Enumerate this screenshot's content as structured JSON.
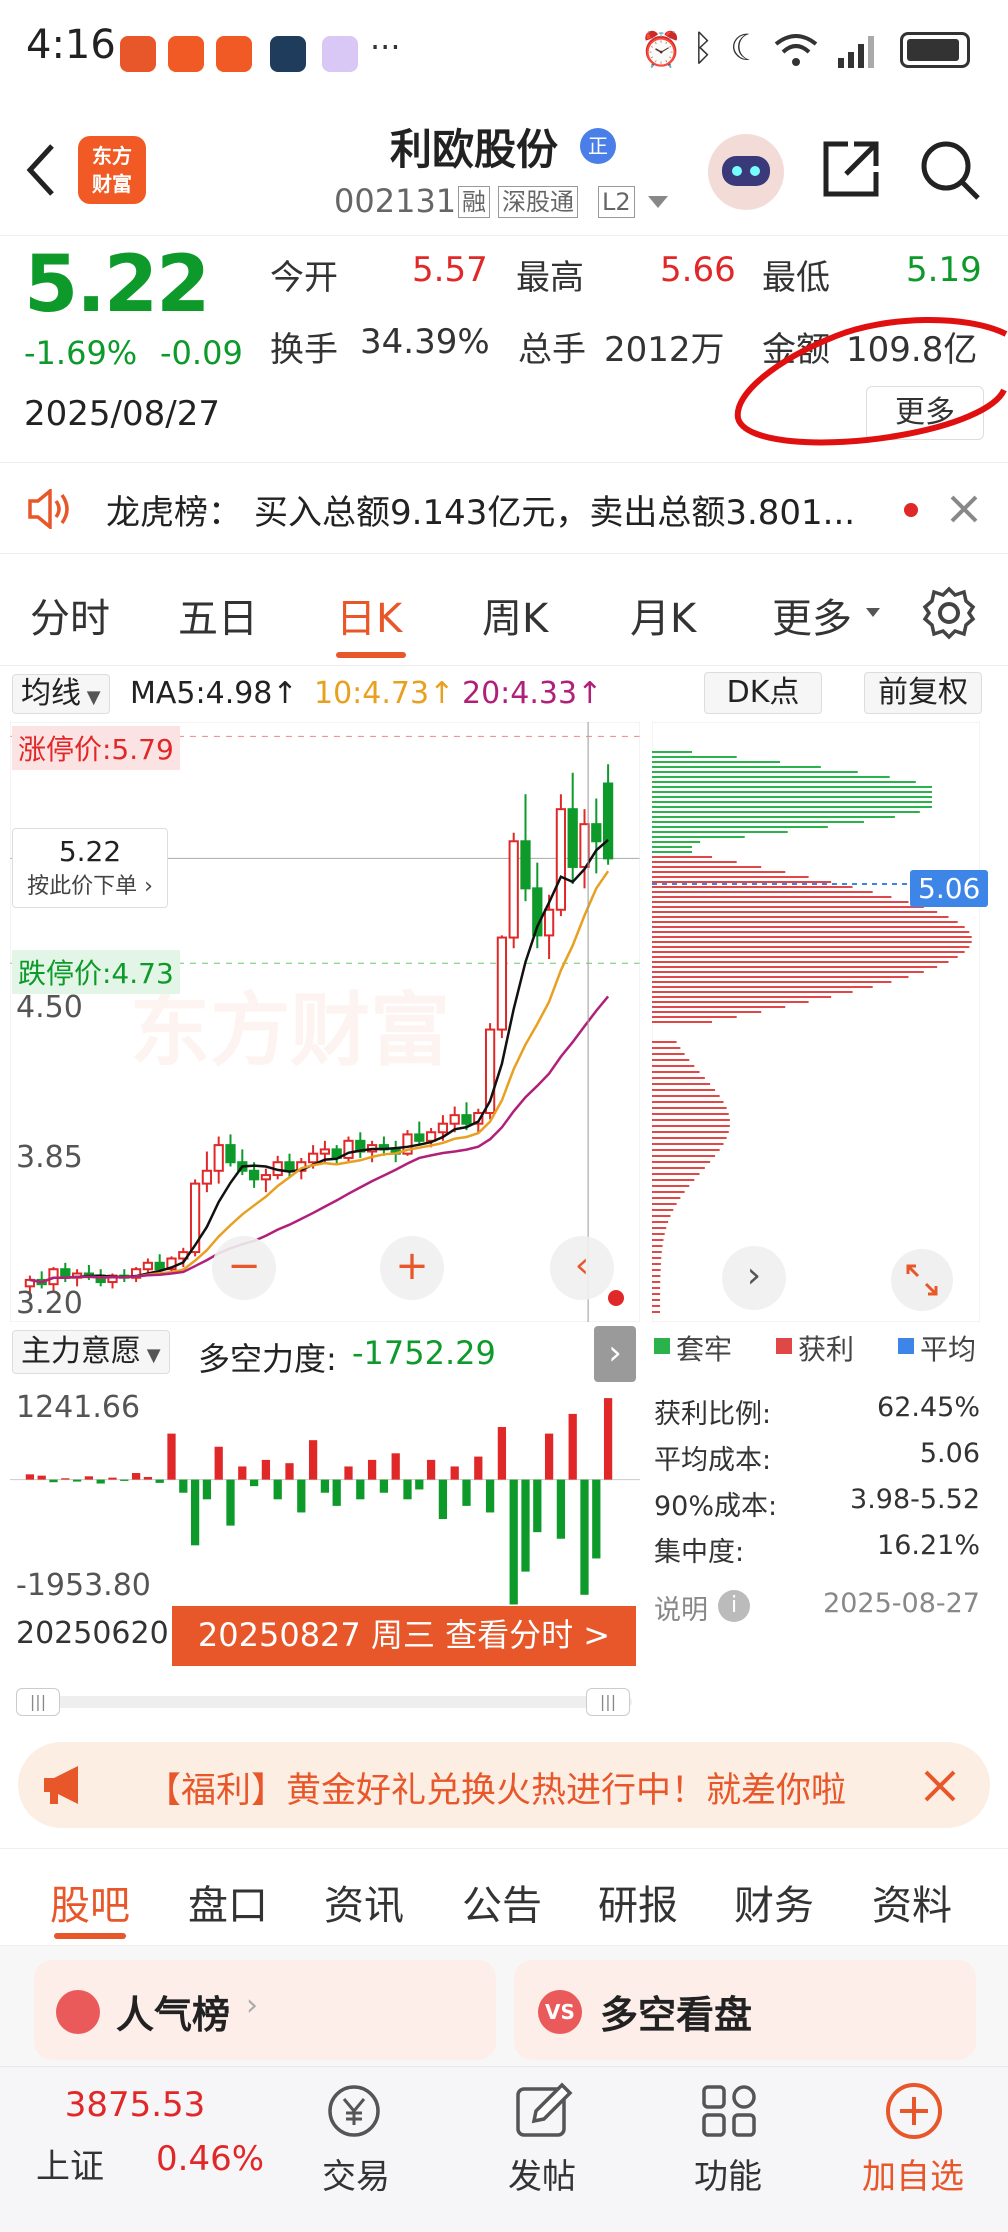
{
  "status": {
    "time": "4:16"
  },
  "nav": {
    "back_icon": "chevron-left-icon",
    "logo_line1": "东方",
    "logo_line2": "财富",
    "stock_name": "利欧股份",
    "name_badge": "正",
    "stock_code": "002131",
    "tag_rong": "融",
    "tag_sgt": "深股通",
    "tag_l2": "L2"
  },
  "quote": {
    "price": "5.22",
    "change_pct": "-1.69%",
    "change_amt": "-0.09",
    "date": "2025/08/27",
    "open_label": "今开",
    "open_value": "5.57",
    "high_label": "最高",
    "high_value": "5.66",
    "low_label": "最低",
    "low_value": "5.19",
    "turnover_label": "换手",
    "turnover_value": "34.39%",
    "volume_label": "总手",
    "volume_value": "2012万",
    "amount_label": "金额",
    "amount_value": "109.8亿",
    "more_button": "更多",
    "colors": {
      "up": "#e02828",
      "down": "#0d9a2a"
    }
  },
  "banner1": {
    "label": "龙虎榜：",
    "text": "买入总额9.143亿元，卖出总额3.801..."
  },
  "ktabs": {
    "tabs": [
      "分时",
      "五日",
      "日K",
      "周K",
      "月K",
      "更多"
    ],
    "active": "日K",
    "settings_icon": "gear-icon"
  },
  "chart": {
    "ma_select": "均线",
    "ma5": "MA5:4.98↑",
    "ma10": "10:4.73↑",
    "ma20": "20:4.33↑",
    "dk_button": "DK点",
    "fq_button": "前复权",
    "limit_up": "涨停价:5.79",
    "current_price": "5.22",
    "order_hint": "按此价下单",
    "limit_down": "跌停价:4.73",
    "y_labels": [
      "4.50",
      "3.85",
      "3.20"
    ],
    "cost_marker": "5.06",
    "indicator_select": "主力意愿",
    "force_label": "多空力度:",
    "force_value": "-1752.29",
    "ind_max": "1241.66",
    "ind_min": "-1953.80",
    "start_date": "20250620",
    "selected_date": "20250827 周三 查看分时 >"
  },
  "chart_data": {
    "type": "candlestick",
    "ma_values": {
      "MA5": 4.98,
      "MA10": 4.73,
      "MA20": 4.33
    },
    "limit_up": 5.79,
    "limit_down": 4.73,
    "last_close": 5.22,
    "candles": [
      [
        3.22,
        3.27,
        3.18,
        3.25
      ],
      [
        3.25,
        3.29,
        3.21,
        3.23
      ],
      [
        3.23,
        3.31,
        3.2,
        3.3
      ],
      [
        3.3,
        3.33,
        3.24,
        3.26
      ],
      [
        3.26,
        3.3,
        3.22,
        3.28
      ],
      [
        3.28,
        3.32,
        3.25,
        3.27
      ],
      [
        3.27,
        3.3,
        3.22,
        3.24
      ],
      [
        3.24,
        3.28,
        3.21,
        3.27
      ],
      [
        3.27,
        3.3,
        3.24,
        3.26
      ],
      [
        3.26,
        3.31,
        3.24,
        3.3
      ],
      [
        3.3,
        3.35,
        3.27,
        3.33
      ],
      [
        3.33,
        3.37,
        3.28,
        3.3
      ],
      [
        3.3,
        3.36,
        3.28,
        3.35
      ],
      [
        3.35,
        3.4,
        3.31,
        3.38
      ],
      [
        3.38,
        3.72,
        3.36,
        3.7
      ],
      [
        3.7,
        3.85,
        3.66,
        3.76
      ],
      [
        3.76,
        3.92,
        3.7,
        3.88
      ],
      [
        3.88,
        3.93,
        3.78,
        3.8
      ],
      [
        3.8,
        3.86,
        3.74,
        3.76
      ],
      [
        3.76,
        3.8,
        3.68,
        3.72
      ],
      [
        3.72,
        3.77,
        3.66,
        3.74
      ],
      [
        3.74,
        3.83,
        3.72,
        3.8
      ],
      [
        3.8,
        3.84,
        3.73,
        3.76
      ],
      [
        3.76,
        3.82,
        3.72,
        3.8
      ],
      [
        3.8,
        3.88,
        3.77,
        3.84
      ],
      [
        3.84,
        3.9,
        3.8,
        3.86
      ],
      [
        3.86,
        3.88,
        3.79,
        3.82
      ],
      [
        3.82,
        3.92,
        3.8,
        3.9
      ],
      [
        3.9,
        3.94,
        3.82,
        3.85
      ],
      [
        3.85,
        3.9,
        3.8,
        3.88
      ],
      [
        3.88,
        3.92,
        3.83,
        3.86
      ],
      [
        3.86,
        3.9,
        3.8,
        3.84
      ],
      [
        3.84,
        3.95,
        3.83,
        3.93
      ],
      [
        3.93,
        3.99,
        3.88,
        3.9
      ],
      [
        3.9,
        3.96,
        3.87,
        3.94
      ],
      [
        3.94,
        4.02,
        3.9,
        3.98
      ],
      [
        3.98,
        4.06,
        3.94,
        4.02
      ],
      [
        4.02,
        4.08,
        3.95,
        3.98
      ],
      [
        3.98,
        4.05,
        3.94,
        4.03
      ],
      [
        4.03,
        4.45,
        4.0,
        4.42
      ],
      [
        4.42,
        4.86,
        4.38,
        4.85
      ],
      [
        4.85,
        5.34,
        4.8,
        5.3
      ],
      [
        5.3,
        5.52,
        5.02,
        5.08
      ],
      [
        5.08,
        5.2,
        4.8,
        4.86
      ],
      [
        4.86,
        5.05,
        4.75,
        4.98
      ],
      [
        4.98,
        5.52,
        4.95,
        5.45
      ],
      [
        5.45,
        5.62,
        5.1,
        5.18
      ],
      [
        5.18,
        5.45,
        5.08,
        5.38
      ],
      [
        5.38,
        5.5,
        5.15,
        5.3
      ],
      [
        5.57,
        5.66,
        5.19,
        5.22
      ]
    ],
    "indicator_range": [
      -1953.8,
      1241.66
    ],
    "indicator_value": -1752.29,
    "chip_distribution": {
      "profit_ratio": "62.45%",
      "avg_cost": "5.06",
      "cost_90": "3.98-5.52",
      "concentration": "16.21%"
    }
  },
  "chip_panel": {
    "legend_trapped": "套牢",
    "legend_profit": "获利",
    "legend_avg": "平均",
    "profit_ratio_label": "获利比例:",
    "profit_ratio_value": "62.45%",
    "avg_cost_label": "平均成本:",
    "avg_cost_value": "5.06",
    "cost90_label": "90%成本:",
    "cost90_value": "3.98-5.52",
    "concentration_label": "集中度:",
    "concentration_value": "16.21%",
    "note_label": "说明",
    "date": "2025-08-27"
  },
  "banner2": {
    "text": "【福利】黄金好礼兑换火热进行中！就差你啦"
  },
  "btabs": {
    "tabs": [
      "股吧",
      "盘口",
      "资讯",
      "公告",
      "研报",
      "财务",
      "资料"
    ],
    "active": "股吧"
  },
  "cards": {
    "card1": "人气榜",
    "card2": "多空看盘"
  },
  "bottom": {
    "index_value": "3875.53",
    "index_name": "上证",
    "index_change": "0.46%",
    "trade": "交易",
    "post": "发帖",
    "function": "功能",
    "add_watch": "加自选"
  }
}
